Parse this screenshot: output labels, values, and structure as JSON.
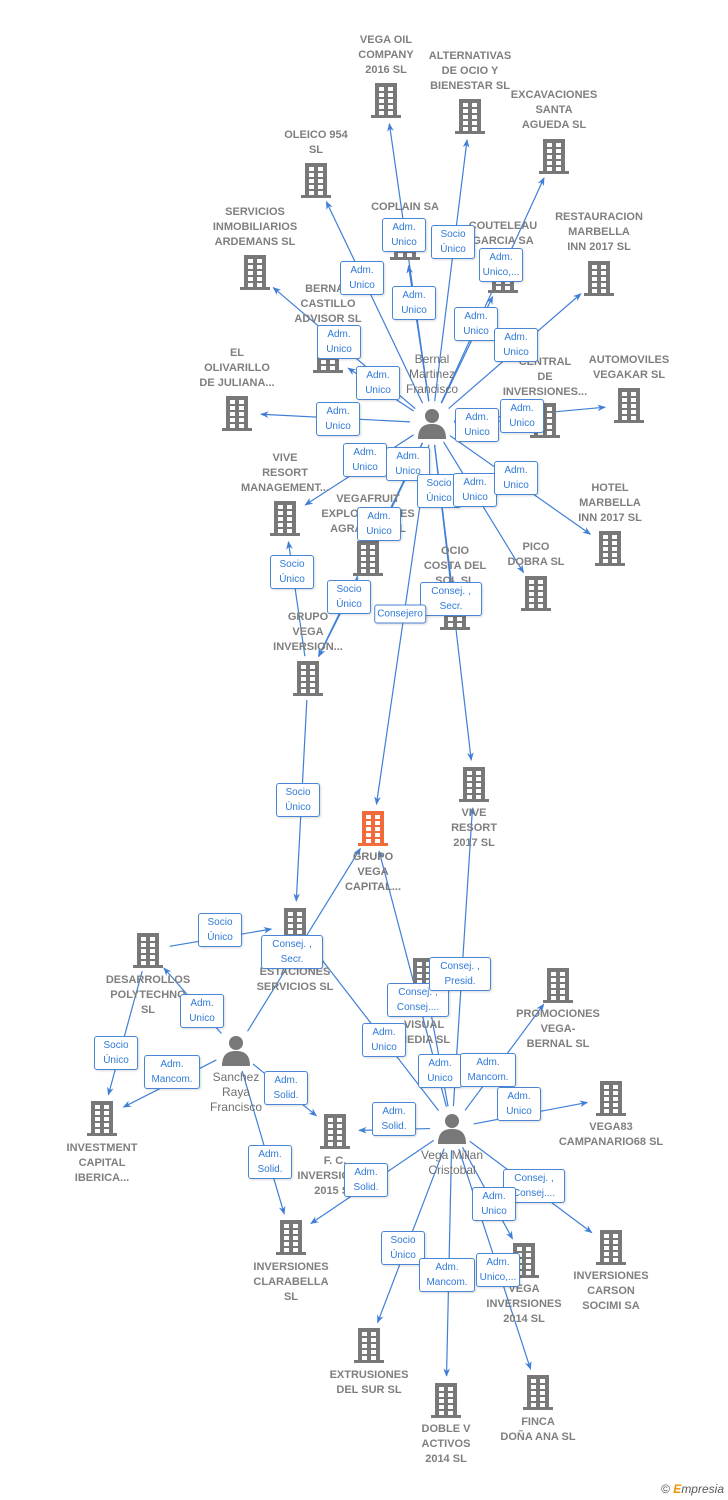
{
  "colors": {
    "edge": "#3f7fd8",
    "node": "#787878",
    "highlight": "#f26b3a",
    "role_text": "#2f7ad8"
  },
  "nodes": [
    {
      "id": "vega_oil",
      "type": "company",
      "lines": [
        "VEGA OIL",
        "COMPANY",
        "2016  SL"
      ]
    },
    {
      "id": "alternativas",
      "type": "company",
      "lines": [
        "ALTERNATIVAS",
        "DE OCIO Y",
        "BIENESTAR  SL"
      ]
    },
    {
      "id": "excavaciones",
      "type": "company",
      "lines": [
        "EXCAVACIONES",
        "SANTA",
        "AGUEDA SL"
      ]
    },
    {
      "id": "oleico",
      "type": "company",
      "lines": [
        "OLEICO 954",
        "SL"
      ]
    },
    {
      "id": "coplain",
      "type": "company",
      "lines": [
        "COPLAIN SA"
      ]
    },
    {
      "id": "couteleau",
      "type": "company",
      "lines": [
        "COUTELEAU",
        "GARCIA SA"
      ]
    },
    {
      "id": "servicios_inm",
      "type": "company",
      "lines": [
        "SERVICIOS",
        "INMOBILIARIOS",
        "ARDEMANS  SL"
      ]
    },
    {
      "id": "restauracion",
      "type": "company",
      "lines": [
        "RESTAURACION",
        "MARBELLA",
        "INN 2017  SL"
      ]
    },
    {
      "id": "bernal_castillo",
      "type": "company",
      "lines": [
        "BERNAL",
        "CASTILLO",
        "ADVISOR SL"
      ]
    },
    {
      "id": "el_olivarillo",
      "type": "company",
      "lines": [
        "EL",
        "OLIVARILLO",
        "DE JULIANA..."
      ]
    },
    {
      "id": "central",
      "type": "company",
      "lines": [
        "CENTRAL",
        "DE",
        "INVERSIONES..."
      ]
    },
    {
      "id": "automoviles",
      "type": "company",
      "lines": [
        "AUTOMOVILES",
        "VEGAKAR SL"
      ]
    },
    {
      "id": "vive_mgmt",
      "type": "company",
      "lines": [
        "VIVE",
        "RESORT",
        "MANAGEMENT..."
      ]
    },
    {
      "id": "vegafruit",
      "type": "company",
      "lines": [
        "VEGAFRUIT",
        "EXPLOTACIONES",
        "AGRARIAS SL"
      ]
    },
    {
      "id": "hotel_marbella",
      "type": "company",
      "lines": [
        "HOTEL",
        "MARBELLA",
        "INN 2017  SL"
      ]
    },
    {
      "id": "ocio_costa",
      "type": "company",
      "lines": [
        "OCIO",
        "COSTA DEL",
        "SOL SL"
      ]
    },
    {
      "id": "pico_dobra",
      "type": "company",
      "lines": [
        "PICO",
        "DOBRA SL"
      ]
    },
    {
      "id": "grupo_vega_inv",
      "type": "company",
      "lines": [
        "GRUPO",
        "VEGA",
        "INVERSION..."
      ]
    },
    {
      "id": "vive_2017",
      "type": "company",
      "lines": [
        "VIVE",
        "RESORT",
        "2017  SL"
      ]
    },
    {
      "id": "grupo_vega_capital",
      "type": "company",
      "highlight": true,
      "lines": [
        "GRUPO",
        "VEGA",
        "CAPITAL..."
      ]
    },
    {
      "id": "estaciones",
      "type": "company",
      "lines": [
        "ESTACIONES",
        "SERVICIOS  SL"
      ]
    },
    {
      "id": "desarrollos",
      "type": "company",
      "lines": [
        "DESARROLLOS",
        "POLYTECHNO",
        "SL"
      ]
    },
    {
      "id": "visual_media",
      "type": "company",
      "lines": [
        "VISUAL",
        "MEDIA  SL"
      ]
    },
    {
      "id": "promociones",
      "type": "company",
      "lines": [
        "PROMOCIONES",
        "VEGA-",
        "BERNAL SL"
      ]
    },
    {
      "id": "vega83",
      "type": "company",
      "lines": [
        "VEGA83",
        "CAMPANARIO68 SL"
      ]
    },
    {
      "id": "investment",
      "type": "company",
      "lines": [
        "INVESTMENT",
        "CAPITAL",
        "IBERICA..."
      ]
    },
    {
      "id": "fc_inv",
      "type": "company",
      "lines": [
        "F. C.",
        "INVERSIONES",
        "2015  SL"
      ]
    },
    {
      "id": "clarabella",
      "type": "company",
      "lines": [
        "INVERSIONES",
        "CLARABELLA",
        "SL"
      ]
    },
    {
      "id": "vega_inv_2014",
      "type": "company",
      "lines": [
        "VEGA",
        "INVERSIONES",
        "2014  SL"
      ]
    },
    {
      "id": "carson",
      "type": "company",
      "lines": [
        "INVERSIONES",
        "CARSON",
        "SOCIMI SA"
      ]
    },
    {
      "id": "extrusiones",
      "type": "company",
      "lines": [
        "EXTRUSIONES",
        "DEL SUR  SL"
      ]
    },
    {
      "id": "doble_v",
      "type": "company",
      "lines": [
        "DOBLE V",
        "ACTIVOS",
        "2014  SL"
      ]
    },
    {
      "id": "finca",
      "type": "company",
      "lines": [
        "FINCA",
        "DOÑA ANA SL"
      ]
    },
    {
      "id": "bernal",
      "type": "person",
      "lines": [
        "Bernal",
        "Martinez",
        "Francisco"
      ]
    },
    {
      "id": "sanchez",
      "type": "person",
      "lines": [
        "Sanchez",
        "Raya",
        "Francisco"
      ]
    },
    {
      "id": "vega_millan",
      "type": "person",
      "lines": [
        "Vega Millan",
        "Cristobal"
      ]
    }
  ],
  "edges": [
    {
      "from": "bernal",
      "to": "vega_oil",
      "role": "Adm. Unico"
    },
    {
      "from": "bernal",
      "to": "alternativas",
      "role": "Socio Único"
    },
    {
      "from": "bernal",
      "to": "excavaciones",
      "role": "Adm. Unico,..."
    },
    {
      "from": "bernal",
      "to": "oleico",
      "role": "Adm. Unico"
    },
    {
      "from": "bernal",
      "to": "coplain",
      "role": "Adm. Unico"
    },
    {
      "from": "bernal",
      "to": "couteleau",
      "role": "Adm. Unico"
    },
    {
      "from": "bernal",
      "to": "restauracion",
      "role": "Adm. Unico"
    },
    {
      "from": "bernal",
      "to": "servicios_inm",
      "role": "Adm. Unico"
    },
    {
      "from": "bernal",
      "to": "bernal_castillo",
      "role": "Adm. Unico"
    },
    {
      "from": "bernal",
      "to": "el_olivarillo",
      "role": "Adm. Unico"
    },
    {
      "from": "bernal",
      "to": "central",
      "role": "Adm. Unico"
    },
    {
      "from": "bernal",
      "to": "automoviles",
      "role": "Adm. Unico"
    },
    {
      "from": "bernal",
      "to": "vive_mgmt",
      "role": "Adm. Unico"
    },
    {
      "from": "bernal",
      "to": "vegafruit",
      "role": "Adm. Unico"
    },
    {
      "from": "bernal",
      "to": "ocio_costa",
      "role": "Socio Único"
    },
    {
      "from": "bernal",
      "to": "pico_dobra",
      "role": "Adm. Unico"
    },
    {
      "from": "bernal",
      "to": "hotel_marbella",
      "role": "Adm. Unico"
    },
    {
      "from": "bernal",
      "to": "grupo_vega_inv",
      "role": "Adm. Unico"
    },
    {
      "from": "bernal",
      "to": "vive_2017",
      "role": "Consej. , Secr."
    },
    {
      "from": "bernal",
      "to": "grupo_vega_capital",
      "role": "Consejero"
    },
    {
      "from": "grupo_vega_inv",
      "to": "vive_mgmt",
      "role": "Socio Único"
    },
    {
      "from": "vegafruit",
      "to": "grupo_vega_inv",
      "role": "Socio Único"
    },
    {
      "from": "grupo_vega_inv",
      "to": "estaciones",
      "role": "Socio Único"
    },
    {
      "from": "sanchez",
      "to": "grupo_vega_capital",
      "role": "Consej. , Secr."
    },
    {
      "from": "desarrollos",
      "to": "estaciones",
      "role": "Socio Único"
    },
    {
      "from": "sanchez",
      "to": "desarrollos",
      "role": "Adm. Unico"
    },
    {
      "from": "sanchez",
      "to": "investment",
      "role": "Adm. Mancom."
    },
    {
      "from": "desarrollos",
      "to": "investment",
      "role": "Socio Único"
    },
    {
      "from": "sanchez",
      "to": "fc_inv",
      "role": "Adm. Solid."
    },
    {
      "from": "sanchez",
      "to": "clarabella",
      "role": "Adm. Solid."
    },
    {
      "from": "vega_millan",
      "to": "grupo_vega_capital",
      "role": "Consej. , Consej...."
    },
    {
      "from": "vega_millan",
      "to": "vive_2017",
      "role": "Consej. , Presid."
    },
    {
      "from": "vega_millan",
      "to": "estaciones",
      "role": "Adm. Unico"
    },
    {
      "from": "vega_millan",
      "to": "visual_media",
      "role": "Adm. Unico"
    },
    {
      "from": "vega_millan",
      "to": "promociones",
      "role": "Adm. Mancom."
    },
    {
      "from": "vega_millan",
      "to": "vega83",
      "role": "Adm. Unico"
    },
    {
      "from": "vega_millan",
      "to": "fc_inv",
      "role": "Adm. Solid."
    },
    {
      "from": "vega_millan",
      "to": "clarabella",
      "role": "Adm. Solid."
    },
    {
      "from": "vega_millan",
      "to": "carson",
      "role": "Consej. , Consej...."
    },
    {
      "from": "vega_millan",
      "to": "vega_inv_2014",
      "role": "Adm. Unico"
    },
    {
      "from": "vega_millan",
      "to": "extrusiones",
      "role": "Socio Único"
    },
    {
      "from": "vega_millan",
      "to": "doble_v",
      "role": "Adm. Mancom."
    },
    {
      "from": "vega_millan",
      "to": "finca",
      "role": "Adm. Unico,..."
    }
  ],
  "brand": {
    "copyright": "©",
    "name_initial": "E",
    "name_rest": "mpresia"
  }
}
